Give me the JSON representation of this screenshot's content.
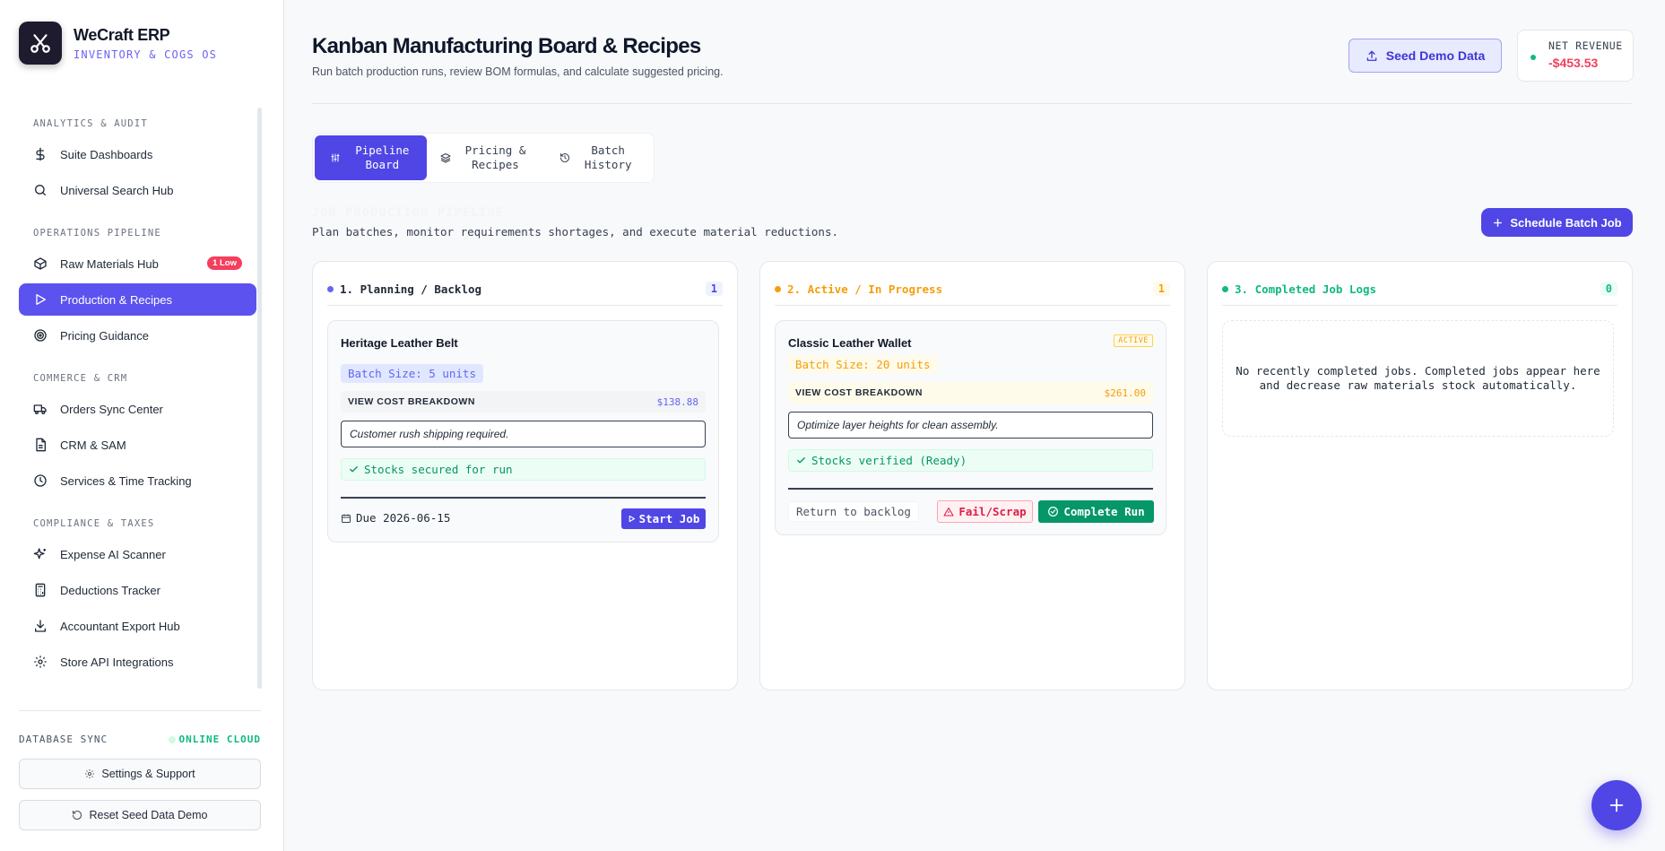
{
  "brand": {
    "title": "WeCraft ERP",
    "subtitle": "INVENTORY & COGS OS"
  },
  "sidebar": {
    "sections": [
      {
        "title": "ANALYTICS & AUDIT",
        "items": [
          {
            "label": "Suite Dashboards",
            "icon": "dollar-icon"
          },
          {
            "label": "Universal Search Hub",
            "icon": "search-icon"
          }
        ]
      },
      {
        "title": "OPERATIONS PIPELINE",
        "items": [
          {
            "label": "Raw Materials Hub",
            "icon": "box-icon",
            "badge": "1 Low"
          },
          {
            "label": "Production & Recipes",
            "icon": "play-icon",
            "active": true
          },
          {
            "label": "Pricing Guidance",
            "icon": "target-icon"
          }
        ]
      },
      {
        "title": "COMMERCE & CRM",
        "items": [
          {
            "label": "Orders Sync Center",
            "icon": "truck-icon"
          },
          {
            "label": "CRM & SAM",
            "icon": "document-icon"
          },
          {
            "label": "Services & Time Tracking",
            "icon": "clock-icon"
          }
        ]
      },
      {
        "title": "COMPLIANCE & TAXES",
        "items": [
          {
            "label": "Expense AI Scanner",
            "icon": "sparkle-icon"
          },
          {
            "label": "Deductions Tracker",
            "icon": "calculator-icon"
          },
          {
            "label": "Accountant Export Hub",
            "icon": "download-icon"
          },
          {
            "label": "Store API Integrations",
            "icon": "gear-icon"
          }
        ]
      }
    ],
    "db_sync_label": "DATABASE SYNC",
    "db_sync_status": "ONLINE CLOUD",
    "settings_label": "Settings & Support",
    "reset_label": "Reset Seed Data Demo"
  },
  "header": {
    "title": "Kanban Manufacturing Board & Recipes",
    "subtitle": "Run batch production runs, review BOM formulas, and calculate suggested pricing.",
    "seed_label": "Seed Demo Data",
    "revenue_label": "NET REVENUE",
    "revenue_value": "-$453.53"
  },
  "tabs": [
    {
      "label": "Pipeline Board",
      "icon": "sliders-icon",
      "active": true
    },
    {
      "label": "Pricing & Recipes",
      "icon": "layers-icon"
    },
    {
      "label": "Batch History",
      "icon": "history-icon"
    }
  ],
  "pipeline": {
    "ghost_title": "JOB PRODUCTION PIPELINE",
    "description": "Plan batches, monitor requirements shortages, and execute material reductions.",
    "schedule_label": "Schedule Batch Job"
  },
  "columns": {
    "planning": {
      "title": "1. Planning / Backlog",
      "count": "1",
      "card": {
        "name": "Heritage Leather Belt",
        "batch": "Batch Size: 5 units",
        "cost_label": "VIEW COST BREAKDOWN",
        "cost_value": "$138.88",
        "note": "Customer rush shipping required.",
        "stock": "Stocks secured for run",
        "due": "Due 2026-06-15",
        "action": "Start Job"
      }
    },
    "active": {
      "title": "2. Active / In Progress",
      "count": "1",
      "card": {
        "name": "Classic Leather Wallet",
        "badge": "ACTIVE",
        "batch": "Batch Size: 20 units",
        "cost_label": "VIEW COST BREAKDOWN",
        "cost_value": "$261.00",
        "note": "Optimize layer heights for clean assembly.",
        "stock": "Stocks verified (Ready)",
        "return_label": "Return to backlog",
        "fail_label": "Fail/Scrap",
        "complete_label": "Complete Run"
      }
    },
    "completed": {
      "title": "3. Completed Job Logs",
      "count": "0",
      "empty": "No recently completed jobs. Completed jobs appear here and decrease raw materials stock automatically."
    }
  },
  "colors": {
    "accent": "#4f46e5",
    "planning": "#6366f1",
    "active": "#f59e0b",
    "completed": "#10b981",
    "danger": "#f43f5e"
  }
}
